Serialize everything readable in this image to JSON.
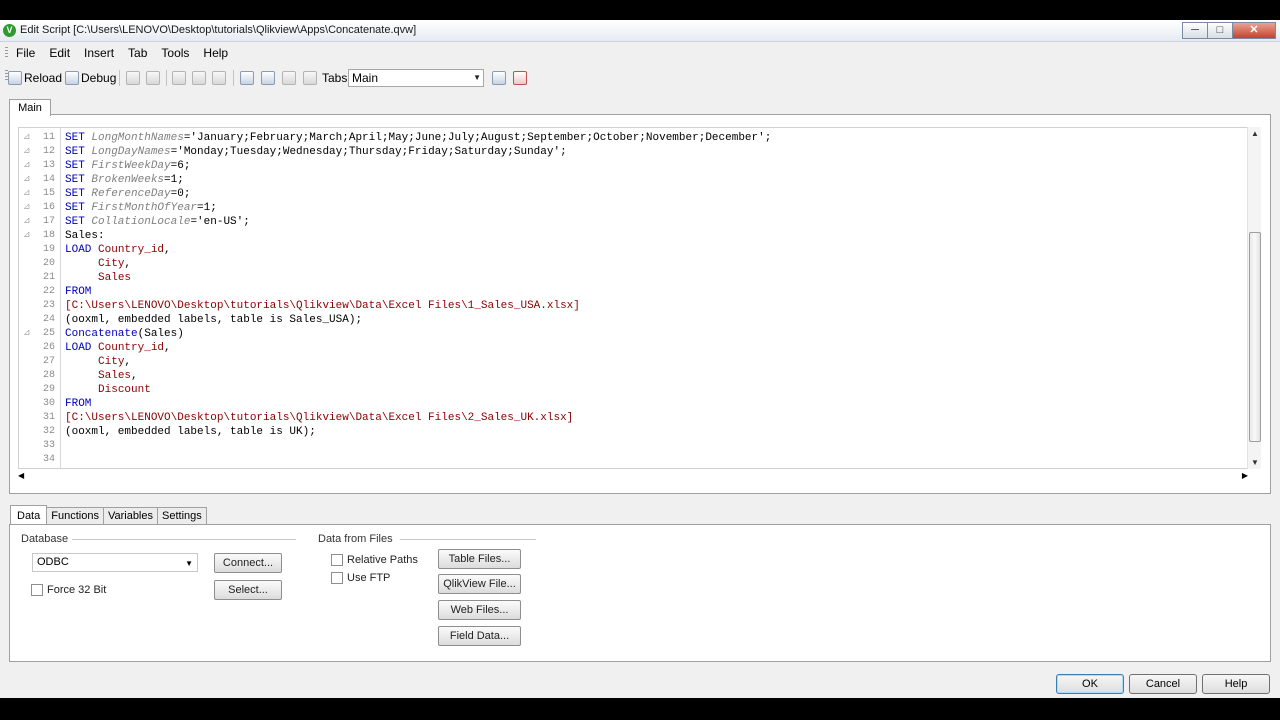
{
  "window": {
    "app_icon_letter": "V",
    "title": "Edit Script [C:\\Users\\LENOVO\\Desktop\\tutorials\\Qlikview\\Apps\\Concatenate.qvw]",
    "minimize": "─",
    "maximize": "□",
    "close": "✕"
  },
  "menu": [
    "File",
    "Edit",
    "Insert",
    "Tab",
    "Tools",
    "Help"
  ],
  "toolbar": {
    "reload_label": "Reload",
    "debug_label": "Debug",
    "tabs_label": "Tabs",
    "tabs_value": "Main"
  },
  "editor": {
    "tab_label": "Main",
    "lines": [
      {
        "n": "11",
        "bookmark": true,
        "segments": [
          [
            "kw",
            "SET "
          ],
          [
            "var",
            "LongMonthNames"
          ],
          [
            "str",
            "='January;February;March;April;May;June;July;August;September;October;November;December';"
          ]
        ]
      },
      {
        "n": "12",
        "bookmark": true,
        "segments": [
          [
            "kw",
            "SET "
          ],
          [
            "var",
            "LongDayNames"
          ],
          [
            "str",
            "='Monday;Tuesday;Wednesday;Thursday;Friday;Saturday;Sunday';"
          ]
        ]
      },
      {
        "n": "13",
        "bookmark": true,
        "segments": [
          [
            "kw",
            "SET "
          ],
          [
            "var",
            "FirstWeekDay"
          ],
          [
            "str",
            "=6;"
          ]
        ]
      },
      {
        "n": "14",
        "bookmark": true,
        "segments": [
          [
            "kw",
            "SET "
          ],
          [
            "var",
            "BrokenWeeks"
          ],
          [
            "str",
            "=1;"
          ]
        ]
      },
      {
        "n": "15",
        "bookmark": true,
        "segments": [
          [
            "kw",
            "SET "
          ],
          [
            "var",
            "ReferenceDay"
          ],
          [
            "str",
            "=0;"
          ]
        ]
      },
      {
        "n": "16",
        "bookmark": true,
        "segments": [
          [
            "kw",
            "SET "
          ],
          [
            "var",
            "FirstMonthOfYear"
          ],
          [
            "str",
            "=1;"
          ]
        ]
      },
      {
        "n": "17",
        "bookmark": true,
        "segments": [
          [
            "kw",
            "SET "
          ],
          [
            "var",
            "CollationLocale"
          ],
          [
            "str",
            "='en-US';"
          ]
        ]
      },
      {
        "n": "18",
        "bookmark": true,
        "segments": [
          [
            "str",
            "Sales:"
          ]
        ]
      },
      {
        "n": "19",
        "bookmark": false,
        "segments": [
          [
            "kw",
            "LOAD "
          ],
          [
            "path",
            "Country_id"
          ],
          [
            "str",
            ","
          ]
        ]
      },
      {
        "n": "20",
        "bookmark": false,
        "segments": [
          [
            "str",
            "     "
          ],
          [
            "path",
            "City"
          ],
          [
            "str",
            ","
          ]
        ]
      },
      {
        "n": "21",
        "bookmark": false,
        "segments": [
          [
            "str",
            "     "
          ],
          [
            "path",
            "Sales"
          ]
        ]
      },
      {
        "n": "22",
        "bookmark": false,
        "segments": [
          [
            "kw",
            "FROM"
          ]
        ]
      },
      {
        "n": "23",
        "bookmark": false,
        "segments": [
          [
            "path",
            "[C:\\Users\\LENOVO\\Desktop\\tutorials\\Qlikview\\Data\\Excel Files\\1_Sales_USA.xlsx]"
          ]
        ]
      },
      {
        "n": "24",
        "bookmark": false,
        "segments": [
          [
            "str",
            "(ooxml, embedded labels, table is Sales_USA);"
          ]
        ]
      },
      {
        "n": "25",
        "bookmark": true,
        "segments": [
          [
            "kw",
            "Concatenate"
          ],
          [
            "str",
            "(Sales)"
          ]
        ]
      },
      {
        "n": "26",
        "bookmark": false,
        "segments": [
          [
            "kw",
            "LOAD "
          ],
          [
            "path",
            "Country_id"
          ],
          [
            "str",
            ","
          ]
        ]
      },
      {
        "n": "27",
        "bookmark": false,
        "segments": [
          [
            "str",
            "     "
          ],
          [
            "path",
            "City"
          ],
          [
            "str",
            ","
          ]
        ]
      },
      {
        "n": "28",
        "bookmark": false,
        "segments": [
          [
            "str",
            "     "
          ],
          [
            "path",
            "Sales"
          ],
          [
            "str",
            ","
          ]
        ]
      },
      {
        "n": "29",
        "bookmark": false,
        "segments": [
          [
            "str",
            "     "
          ],
          [
            "path",
            "Discount"
          ]
        ]
      },
      {
        "n": "30",
        "bookmark": false,
        "segments": [
          [
            "kw",
            "FROM"
          ]
        ]
      },
      {
        "n": "31",
        "bookmark": false,
        "segments": [
          [
            "path",
            "[C:\\Users\\LENOVO\\Desktop\\tutorials\\Qlikview\\Data\\Excel Files\\2_Sales_UK.xlsx]"
          ]
        ]
      },
      {
        "n": "32",
        "bookmark": false,
        "segments": [
          [
            "str",
            "(ooxml, embedded labels, table is UK);"
          ]
        ]
      },
      {
        "n": "33",
        "bookmark": false,
        "segments": []
      },
      {
        "n": "34",
        "bookmark": false,
        "segments": []
      }
    ]
  },
  "bottom": {
    "tabs": [
      "Data",
      "Functions",
      "Variables",
      "Settings"
    ],
    "database_label": "Database",
    "database_value": "ODBC",
    "connect_label": "Connect...",
    "select_label": "Select...",
    "force32_label": "Force 32 Bit",
    "files_label": "Data from Files",
    "relative_paths_label": "Relative Paths",
    "use_ftp_label": "Use FTP",
    "table_files_label": "Table Files...",
    "qlikview_file_label": "QlikView File...",
    "web_files_label": "Web Files...",
    "field_data_label": "Field Data..."
  },
  "dialog": {
    "ok_label": "OK",
    "cancel_label": "Cancel",
    "help_label": "Help"
  }
}
